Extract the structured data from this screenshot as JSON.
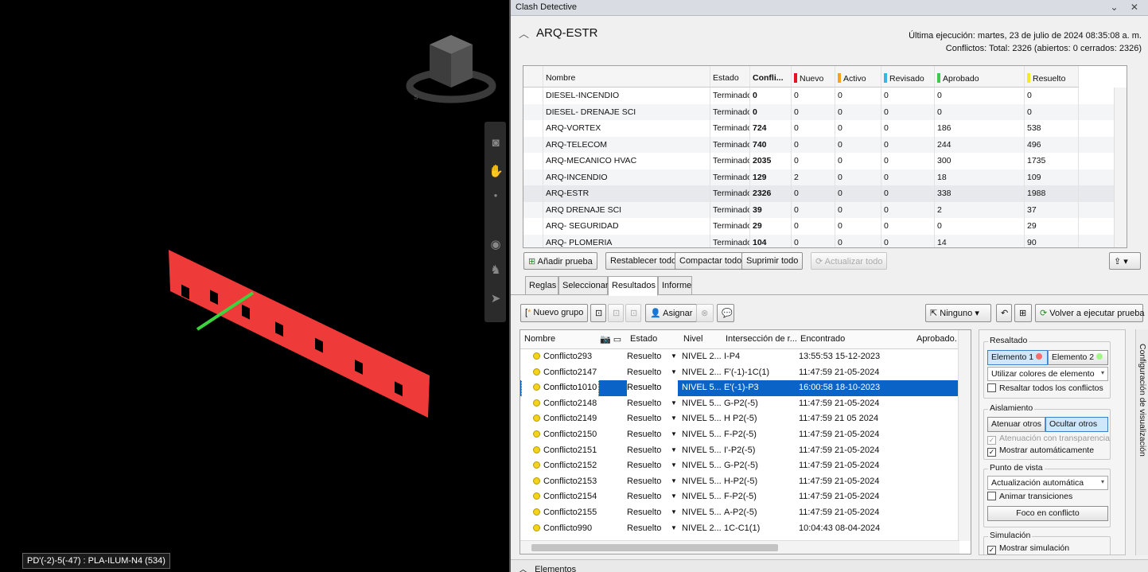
{
  "viewport": {
    "status_label": "PD'(-2)-5(-47) : PLA-ILUM-N4 (534)"
  },
  "panel": {
    "title": "Clash Detective",
    "title_buttons": "⌄ ✕",
    "test_name": "ARQ-ESTR",
    "last_run": "Última ejecución:  martes, 23 de julio de 2024 08:35:08 a. m.",
    "conflicts_summary": "Conflictos: Total:  2326  (abiertos:  0  cerrados:  2326)"
  },
  "tests_table": {
    "headers": [
      "Nombre",
      "Estado",
      "Confli...",
      "Nuevo",
      "Activo",
      "Revisado",
      "Aprobado",
      "Resuelto"
    ],
    "header_colors": {
      "Nuevo": "#e81123",
      "Activo": "#f7a21b",
      "Revisado": "#39b4e8",
      "Aprobado": "#3fc84c",
      "Resuelto": "#f3ea2a"
    },
    "rows": [
      [
        "DIESEL-INCENDIO",
        "Terminado",
        "0",
        "0",
        "0",
        "0",
        "0",
        "0"
      ],
      [
        "DIESEL- DRENAJE SCI",
        "Terminado",
        "0",
        "0",
        "0",
        "0",
        "0",
        "0"
      ],
      [
        "ARQ-VORTEX",
        "Terminado",
        "724",
        "0",
        "0",
        "0",
        "186",
        "538"
      ],
      [
        "ARQ-TELECOM",
        "Terminado",
        "740",
        "0",
        "0",
        "0",
        "244",
        "496"
      ],
      [
        "ARQ-MECANICO HVAC",
        "Terminado",
        "2035",
        "0",
        "0",
        "0",
        "300",
        "1735"
      ],
      [
        "ARQ-INCENDIO",
        "Terminado",
        "129",
        "2",
        "0",
        "0",
        "18",
        "109"
      ],
      [
        "ARQ-ESTR",
        "Terminado",
        "2326",
        "0",
        "0",
        "0",
        "338",
        "1988"
      ],
      [
        "ARQ DRENAJE SCI",
        "Terminado",
        "39",
        "0",
        "0",
        "0",
        "2",
        "37"
      ],
      [
        "ARQ- SEGURIDAD",
        "Terminado",
        "29",
        "0",
        "0",
        "0",
        "0",
        "29"
      ],
      [
        "ARQ- PLOMERIA",
        "Terminado",
        "104",
        "0",
        "0",
        "0",
        "14",
        "90"
      ]
    ]
  },
  "test_buttons": {
    "add": "Añadir prueba",
    "reset": "Restablecer todo",
    "compact": "Compactar todo",
    "delete": "Suprimir todo",
    "update": "Actualizar todo"
  },
  "tabs": [
    "Reglas",
    "Seleccionar",
    "Resultados",
    "Informe"
  ],
  "results_toolbar": {
    "new_group": "Nuevo grupo",
    "assign": "Asignar",
    "none": "Ninguno",
    "rerun": "Volver a ejecutar prueba"
  },
  "results_table": {
    "headers": [
      "Nombre",
      "Estado",
      "Nivel",
      "Intersección de r...",
      "Encontrado",
      "Aprobado."
    ],
    "rows": [
      [
        "Conflicto293",
        "Resuelto",
        "NIVEL 2...",
        "I-P4",
        "13:55:53 15-12-2023"
      ],
      [
        "Conflicto2147",
        "Resuelto",
        "NIVEL 2...",
        "F'(-1)-1C(1)",
        "11:47:59 21-05-2024"
      ],
      [
        "Conflicto1010",
        "Resuelto",
        "NIVEL 5...",
        "E'(-1)-P3",
        "16:00:58 18-10-2023"
      ],
      [
        "Conflicto2148",
        "Resuelto",
        "NIVEL 5...",
        "G-P2(-5)",
        "11:47:59 21-05-2024"
      ],
      [
        "Conflicto2149",
        "Resuelto",
        "NIVEL 5...",
        "H P2(-5)",
        "11:47:59 21 05 2024"
      ],
      [
        "Conflicto2150",
        "Resuelto",
        "NIVEL 5...",
        "F-P2(-5)",
        "11:47:59 21-05-2024"
      ],
      [
        "Conflicto2151",
        "Resuelto",
        "NIVEL 5...",
        "I'-P2(-5)",
        "11:47:59 21-05-2024"
      ],
      [
        "Conflicto2152",
        "Resuelto",
        "NIVEL 5...",
        "G-P2(-5)",
        "11:47:59 21-05-2024"
      ],
      [
        "Conflicto2153",
        "Resuelto",
        "NIVEL 5...",
        "H-P2(-5)",
        "11:47:59 21-05-2024"
      ],
      [
        "Conflicto2154",
        "Resuelto",
        "NIVEL 5...",
        "F-P2(-5)",
        "11:47:59 21-05-2024"
      ],
      [
        "Conflicto2155",
        "Resuelto",
        "NIVEL 5...",
        "A-P2(-5)",
        "11:47:59 21-05-2024"
      ],
      [
        "Conflicto990",
        "Resuelto",
        "NIVEL 2...",
        "1C-C1(1)",
        "10:04:43 08-04-2024"
      ]
    ],
    "selected_index": 2
  },
  "settings": {
    "highlight_title": "Resaltado",
    "element1": "Elemento 1",
    "element2": "Elemento 2",
    "element1_color": "#ff6b6b",
    "element2_color": "#a6f58a",
    "use_colors": "Utilizar colores de elemento",
    "highlight_all": "Resaltar todos los conflictos",
    "isolation_title": "Aislamiento",
    "dim_others": "Atenuar otros",
    "hide_others": "Ocultar otros",
    "transparency": "Atenuación con transparencia",
    "auto_show": "Mostrar automáticamente",
    "viewpoint_title": "Punto de vista",
    "auto_update": "Actualización automática",
    "animate": "Animar transiciones",
    "focus": "Foco en conflicto",
    "simulation_title": "Simulación",
    "show_sim": "Mostrar simulación"
  },
  "side_tab": "Configuración de visualización",
  "elements_bar": "Elementos",
  "colors": {
    "selection": "#0a64c8",
    "wall": "#ef3a3a",
    "clash_line": "#3fd23f"
  }
}
